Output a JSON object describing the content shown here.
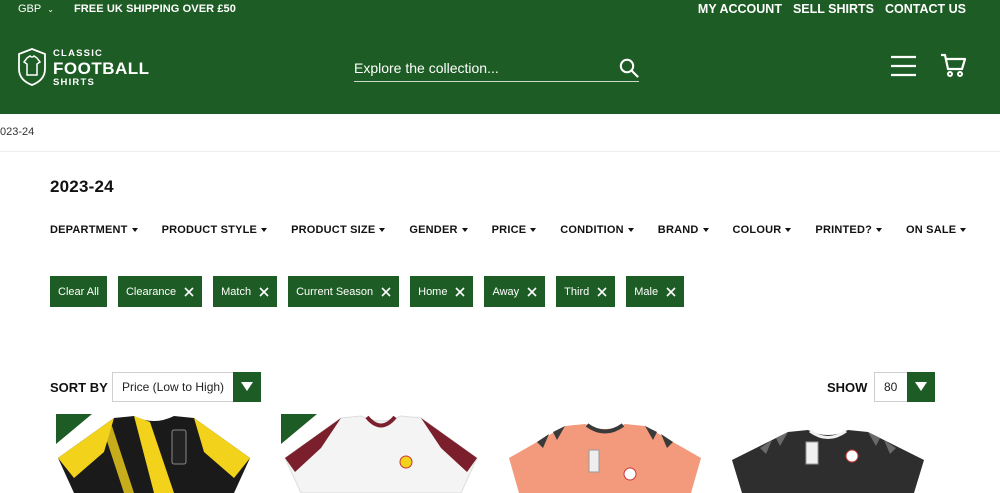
{
  "topbar": {
    "currency": "GBP",
    "shipping": "FREE UK SHIPPING OVER £50",
    "links": [
      "MY ACCOUNT",
      "SELL SHIRTS",
      "CONTACT US"
    ]
  },
  "logo": {
    "line1": "CLASSIC",
    "line2": "FOOTBALL",
    "line3": "SHIRTS"
  },
  "search": {
    "placeholder": "Explore the collection..."
  },
  "breadcrumb": "023-24",
  "page_title": "2023-24",
  "filters": [
    "DEPARTMENT",
    "PRODUCT STYLE",
    "PRODUCT SIZE",
    "GENDER",
    "PRICE",
    "CONDITION",
    "BRAND",
    "COLOUR",
    "PRINTED?",
    "ON SALE"
  ],
  "chips": [
    "Clear All",
    "Clearance",
    "Match",
    "Current Season",
    "Home",
    "Away",
    "Third",
    "Male"
  ],
  "sort": {
    "label": "SORT BY",
    "value": "Price (Low to High)"
  },
  "show": {
    "label": "SHOW",
    "value": "80"
  },
  "colors": {
    "brand_green": "#1e5c25"
  },
  "products": [
    {
      "colors": [
        "#f2d21b",
        "#1a1a1a"
      ],
      "badge": true
    },
    {
      "colors": [
        "#f4f4f4",
        "#7a1f2b"
      ],
      "badge": true
    },
    {
      "colors": [
        "#f39a7c",
        "#3a3a3a"
      ],
      "badge": false
    },
    {
      "colors": [
        "#2e2e2e",
        "#f0f0f0"
      ],
      "badge": false
    }
  ]
}
